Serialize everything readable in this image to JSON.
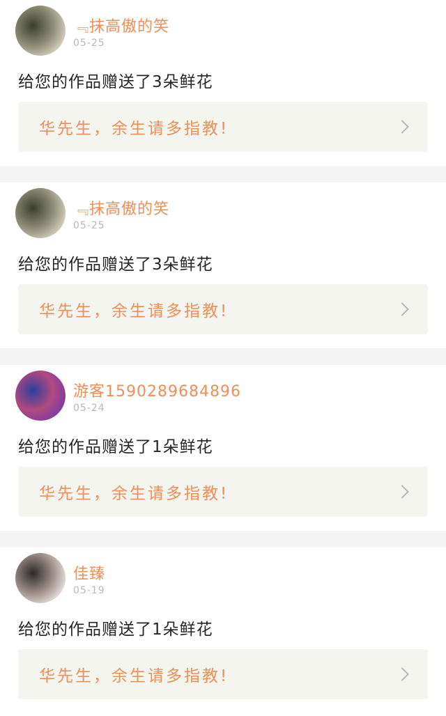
{
  "gifts": [
    {
      "user": "﹃抹高傲的笑",
      "date": "05-25",
      "message": "给您的作品赠送了3朵鲜花",
      "work_title": "华先生，余生请多指教!",
      "avatar_colors": [
        "#3b3f31",
        "#8c8a74",
        "#d9d3c4"
      ]
    },
    {
      "user": "﹃抹高傲的笑",
      "date": "05-25",
      "message": "给您的作品赠送了3朵鲜花",
      "work_title": "华先生，余生请多指教!",
      "avatar_colors": [
        "#3b3f31",
        "#8c8a74",
        "#d9d3c4"
      ]
    },
    {
      "user": "游客1590289684896",
      "date": "05-24",
      "message": "给您的作品赠送了1朵鲜花",
      "work_title": "华先生，余生请多指教!",
      "avatar_colors": [
        "#2c3f9c",
        "#b04a7f",
        "#7c3aa6"
      ]
    },
    {
      "user": "佳臻",
      "date": "05-19",
      "message": "给您的作品赠送了1朵鲜花",
      "work_title": "华先生，余生请多指教!",
      "avatar_colors": [
        "#2a2a2a",
        "#9d8d88",
        "#e9e4e1"
      ]
    }
  ],
  "colors": {
    "username": "#ef8f57",
    "date": "#b8b8b8",
    "message": "#262626",
    "work_card_bg": "#f5f5f0"
  }
}
